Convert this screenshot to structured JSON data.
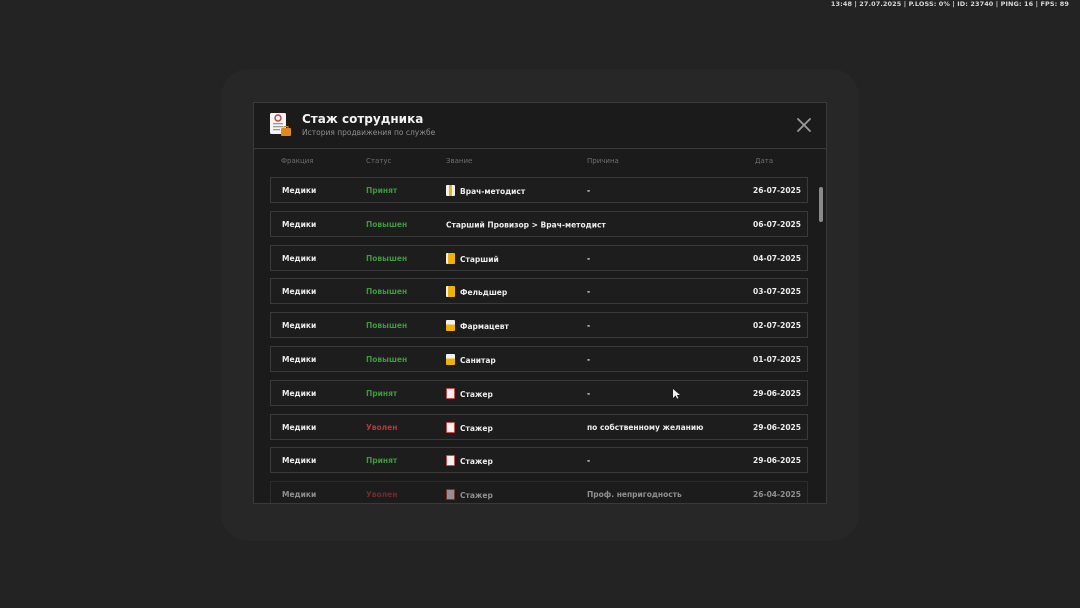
{
  "hud": {
    "text": "13:48 | 27.07.2025 | P.LOSS: 0% | ID: 23740 | PING: 16 | FPS: 89"
  },
  "modal": {
    "title": "Стаж сотрудника",
    "subtitle": "История продвижения по службе",
    "icon": "document-icon",
    "close_icon": "close-icon"
  },
  "columns": {
    "faction": "Фракция",
    "status": "Статус",
    "rank": "Звание",
    "reason": "Причина",
    "date": "Дата"
  },
  "colors": {
    "accepted": "#3b9a3b",
    "promoted": "#3b9a3b",
    "fired": "#b03a3a",
    "rank_gold": "#f0b400",
    "rank_white": "#f2f2f2"
  },
  "rows": [
    {
      "faction": "Медики",
      "status": "Принят",
      "rank": "Врач-методист",
      "reason": "-",
      "date": "26-07-2025",
      "status_type": "green",
      "rank_icon": "rank-stripe-icon"
    },
    {
      "faction": "Медики",
      "status": "Повышен",
      "rank": "Старший Провизор > Врач-методист",
      "reason": "",
      "date": "06-07-2025",
      "status_type": "green",
      "rank_icon": ""
    },
    {
      "faction": "Медики",
      "status": "Повышен",
      "rank": "Старший",
      "reason": "-",
      "date": "04-07-2025",
      "status_type": "green",
      "rank_icon": "rank-gold-full-icon"
    },
    {
      "faction": "Медики",
      "status": "Повышен",
      "rank": "Фельдшер",
      "reason": "-",
      "date": "03-07-2025",
      "status_type": "green",
      "rank_icon": "rank-gold-full-icon"
    },
    {
      "faction": "Медики",
      "status": "Повышен",
      "rank": "Фармацевт",
      "reason": "-",
      "date": "02-07-2025",
      "status_type": "green",
      "rank_icon": "rank-gold-half-icon"
    },
    {
      "faction": "Медики",
      "status": "Повышен",
      "rank": "Санитар",
      "reason": "-",
      "date": "01-07-2025",
      "status_type": "green",
      "rank_icon": "rank-gold-half-icon"
    },
    {
      "faction": "Медики",
      "status": "Принят",
      "rank": "Стажер",
      "reason": "-",
      "date": "29-06-2025",
      "status_type": "green",
      "rank_icon": "rank-blank-icon"
    },
    {
      "faction": "Медики",
      "status": "Уволен",
      "rank": "Стажер",
      "reason": "по собственному желанию",
      "date": "29-06-2025",
      "status_type": "red",
      "rank_icon": "rank-blank-icon"
    },
    {
      "faction": "Медики",
      "status": "Принят",
      "rank": "Стажер",
      "reason": "-",
      "date": "29-06-2025",
      "status_type": "green",
      "rank_icon": "rank-blank-icon"
    },
    {
      "faction": "Медики",
      "status": "Уволен",
      "rank": "Стажер",
      "reason": "Проф. непригодность",
      "date": "26-04-2025",
      "status_type": "red",
      "rank_icon": "rank-blank-icon"
    }
  ]
}
